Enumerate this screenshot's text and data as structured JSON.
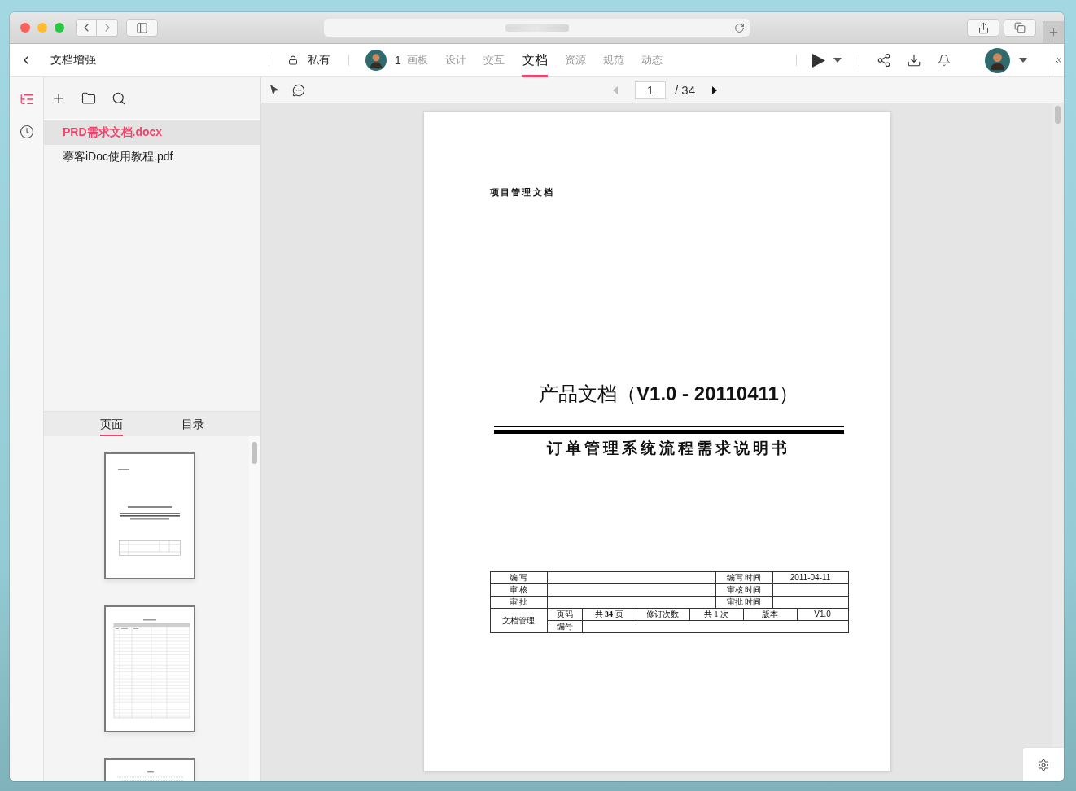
{
  "header": {
    "title": "文档增强",
    "visibility": "私有",
    "member_count": "1",
    "tabs": [
      {
        "label": "画板",
        "selected": false
      },
      {
        "label": "设计",
        "selected": false
      },
      {
        "label": "交互",
        "selected": false
      },
      {
        "label": "文档",
        "selected": true
      },
      {
        "label": "资源",
        "selected": false
      },
      {
        "label": "规范",
        "selected": false
      },
      {
        "label": "动态",
        "selected": false
      }
    ]
  },
  "rail": {
    "items": [
      {
        "kind": "outline",
        "selected": true
      },
      {
        "kind": "history",
        "selected": false
      }
    ]
  },
  "files": {
    "items": [
      {
        "name": "PRD需求文档.docx",
        "selected": true
      },
      {
        "name": "摹客iDoc使用教程.pdf",
        "selected": false
      }
    ],
    "view_tabs": [
      {
        "label": "页面",
        "selected": true
      },
      {
        "label": "目录",
        "selected": false
      }
    ],
    "thumbnails": [
      {
        "kind": "cover"
      },
      {
        "kind": "table"
      },
      {
        "kind": "contents"
      }
    ]
  },
  "viewer": {
    "prev": {
      "disabled": true
    },
    "page": "1",
    "total": "/ 34",
    "next": {
      "disabled": false
    }
  },
  "document": {
    "header": "项目管理文档",
    "title": "产品文档（**V1.0 - 20110411**）",
    "subtitle": "订单管理系统流程需求说明书",
    "approvals": [
      {
        "role": "编 写",
        "time_label": "编写 时间",
        "time": "2011-04-11"
      },
      {
        "role": "审 核",
        "time_label": "审核 时间"
      },
      {
        "role": "审 批",
        "time_label": "审批 时间"
      }
    ],
    "management": {
      "label": "文档管理",
      "page_label": "页码",
      "pages": "共 **34** 页",
      "revisions_label": "修订次数",
      "revisions": "共 1 次",
      "version_label": "版本",
      "version": "V1.0",
      "number_label": "编号"
    }
  }
}
